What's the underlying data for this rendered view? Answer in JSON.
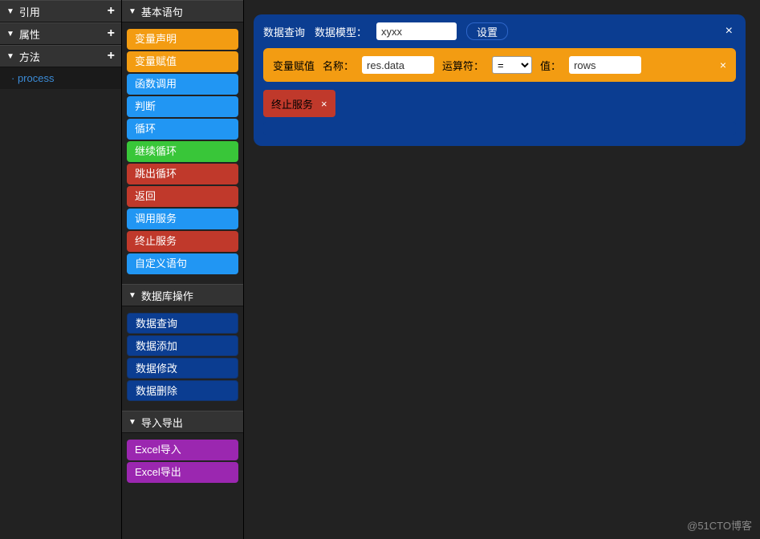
{
  "left": {
    "sections": [
      {
        "label": "引用",
        "plus": true
      },
      {
        "label": "属性",
        "plus": true
      },
      {
        "label": "方法",
        "plus": true
      }
    ],
    "method_item": "process"
  },
  "mid": {
    "groups": {
      "basic": {
        "title": "基本语句",
        "items": [
          {
            "label": "变量声明",
            "color": "c-orange"
          },
          {
            "label": "变量赋值",
            "color": "c-orange"
          },
          {
            "label": "函数调用",
            "color": "c-blue"
          },
          {
            "label": "判断",
            "color": "c-blue"
          },
          {
            "label": "循环",
            "color": "c-blue"
          },
          {
            "label": "继续循环",
            "color": "c-green"
          },
          {
            "label": "跳出循环",
            "color": "c-red"
          },
          {
            "label": "返回",
            "color": "c-red"
          },
          {
            "label": "调用服务",
            "color": "c-blue"
          },
          {
            "label": "终止服务",
            "color": "c-red"
          },
          {
            "label": "自定义语句",
            "color": "c-blue"
          }
        ]
      },
      "db": {
        "title": "数据库操作",
        "items": [
          {
            "label": "数据查询",
            "color": "c-navy"
          },
          {
            "label": "数据添加",
            "color": "c-navy"
          },
          {
            "label": "数据修改",
            "color": "c-navy"
          },
          {
            "label": "数据删除",
            "color": "c-navy"
          }
        ]
      },
      "io": {
        "title": "导入导出",
        "items": [
          {
            "label": "Excel导入",
            "color": "c-purple"
          },
          {
            "label": "Excel导出",
            "color": "c-purple"
          }
        ]
      }
    }
  },
  "canvas": {
    "query": {
      "title": "数据查询",
      "model_label": "数据模型：",
      "model_value": "xyxx",
      "settings_btn": "设置"
    },
    "assign": {
      "title": "变量赋值",
      "name_label": "名称：",
      "name_value": "res.data",
      "op_label": "运算符：",
      "op_value": "=",
      "val_label": "值：",
      "val_value": "rows"
    },
    "term": {
      "title": "终止服务"
    }
  },
  "watermark": "@51CTO博客"
}
